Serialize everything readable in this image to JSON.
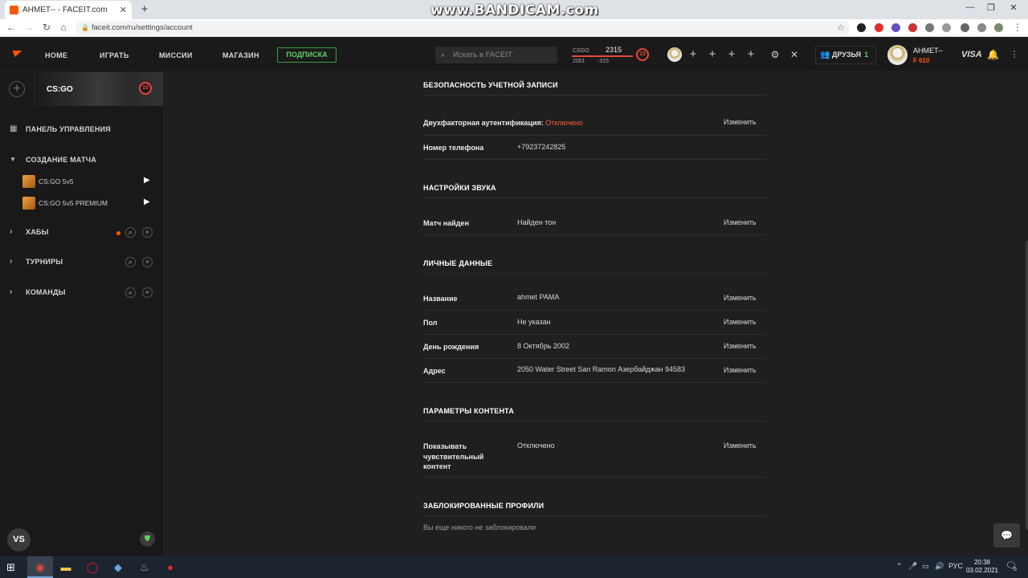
{
  "browser": {
    "tab_title": "AHMET-- - FACEIT.com",
    "tab_close": "✕",
    "new_tab": "+",
    "url": "faceit.com/ru/settings/account",
    "watermark": "www.BANDICAM.com",
    "window_controls": [
      "—",
      "❐",
      "✕"
    ]
  },
  "header": {
    "nav": [
      "HOME",
      "ИГРАТЬ",
      "МИССИИ",
      "МАГАЗИН"
    ],
    "subscribe_label": "ПОДПИСКА",
    "search_placeholder": "Искать в FACEIT",
    "elo": {
      "game": "CSGO",
      "value": "2315",
      "min": "2001",
      "diff": "-315",
      "level": "10"
    },
    "friends_label": "ДРУЗЬЯ",
    "friends_count": "1",
    "username": "AHMET--",
    "points": "F 610",
    "visa_label": "VISA"
  },
  "sidebar": {
    "game_name": "CS:GO",
    "game_level": "10",
    "dashboard": "ПАНЕЛЬ УПРАВЛЕНИЯ",
    "matchmaking": "СОЗДАНИЕ МАТЧА",
    "queues": [
      "CS:GO 5v5",
      "CS:GO 5v5 PREMIUM"
    ],
    "hubs": "ХАБЫ",
    "tournaments": "ТУРНИРЫ",
    "teams": "КОМАНДЫ",
    "vs_label": "VS"
  },
  "settings": {
    "security": {
      "title": "БЕЗОПАСНОСТЬ УЧЕТНОЙ ЗАПИСИ",
      "twofa_label": "Двухфакторная аутентификация:",
      "twofa_status": "Отключено",
      "phone_label": "Номер телефона",
      "phone_value": "+79237242825"
    },
    "sound": {
      "title": "НАСТРОЙКИ ЗВУКА",
      "match_found_label": "Матч найден",
      "match_found_value": "Найден тон"
    },
    "personal": {
      "title": "ЛИЧНЫЕ ДАННЫЕ",
      "name_label": "Название",
      "name_value": "ahmet PAMA",
      "gender_label": "Пол",
      "gender_value": "Не указан",
      "birthday_label": "День рождения",
      "birthday_value": "8 Октябрь 2002",
      "address_label": "Адрес",
      "address_value": "2050 Water Street San Ramon Азербайджан 94583"
    },
    "content": {
      "title": "ПАРАМЕТРЫ КОНТЕНТА",
      "sensitive_label": "Показывать чувствительный контент",
      "sensitive_value": "Отключено"
    },
    "blocked": {
      "title": "ЗАБЛОКИРОВАННЫЕ ПРОФИЛИ",
      "note": "Вы еще никого не заблокировали"
    },
    "edit_label": "Изменить"
  },
  "taskbar": {
    "lang": "РУС",
    "time": "20:38",
    "date": "03.02.2021",
    "notif_count": "5"
  },
  "colors": {
    "accent": "#ff5500",
    "disabled_status": "#ff5a3c",
    "subscribe_green": "#5fcf5f",
    "level_red": "#e8473b"
  }
}
